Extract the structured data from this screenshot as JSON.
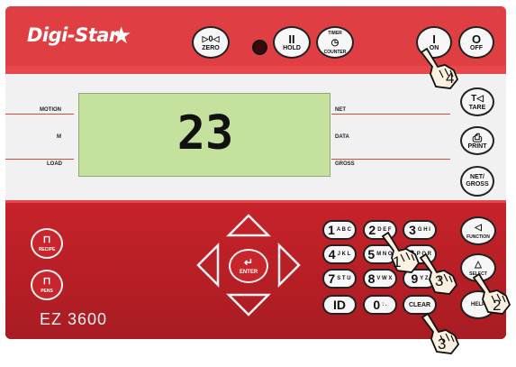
{
  "brand": {
    "name": "Digi-Star",
    "star": "★"
  },
  "model": "EZ 3600",
  "display": {
    "value": "23"
  },
  "indicators_left": [
    "MOTION",
    "M",
    "LOAD"
  ],
  "indicators_right": [
    "NET",
    "DATA",
    "GROSS"
  ],
  "top_buttons": {
    "zero": {
      "symbol": "▷0◁",
      "label": "ZERO"
    },
    "hold": {
      "symbol": "II",
      "label": "HOLD"
    },
    "timer": {
      "symbol": "TIMER",
      "label": "COUNTER"
    },
    "on": {
      "symbol": "I",
      "label": "ON"
    },
    "off": {
      "symbol": "O",
      "label": "OFF"
    }
  },
  "side_buttons": {
    "tare": {
      "symbol": "T◁",
      "label": "TARE"
    },
    "print": {
      "symbol": "⎙",
      "label": "PRINT"
    },
    "netgross": {
      "label1": "NET/",
      "label2": "GROSS"
    }
  },
  "left_buttons": {
    "recipe": {
      "label": "RECIPE"
    },
    "pens": {
      "label": "PENS"
    }
  },
  "nav": {
    "enter": "ENTER"
  },
  "keypad": [
    {
      "num": "1",
      "sub": "A B C"
    },
    {
      "num": "2",
      "sub": "D E F"
    },
    {
      "num": "3",
      "sub": "G H I"
    },
    {
      "num": "4",
      "sub": "J K L"
    },
    {
      "num": "5",
      "sub": "M N O"
    },
    {
      "num": "6",
      "sub": "P Q R"
    },
    {
      "num": "7",
      "sub": "S T U"
    },
    {
      "num": "8",
      "sub": "V W X"
    },
    {
      "num": "9",
      "sub": "Y Z"
    },
    {
      "num": "ID",
      "sub": ""
    },
    {
      "num": "0",
      "sub": ": ."
    },
    {
      "num": "CLEAR",
      "sub": ""
    }
  ],
  "right_column": {
    "function": {
      "symbol": "◁",
      "label": "FUNCTION"
    },
    "select": {
      "symbol": "△",
      "label": "SELECT"
    },
    "help": {
      "label": "HELP"
    }
  },
  "step_labels": [
    "4",
    "1",
    "3",
    "2",
    "3"
  ],
  "colors": {
    "panel": "#e8484c",
    "lower_panel": "#b51e25",
    "lcd": "#c4e29d"
  }
}
